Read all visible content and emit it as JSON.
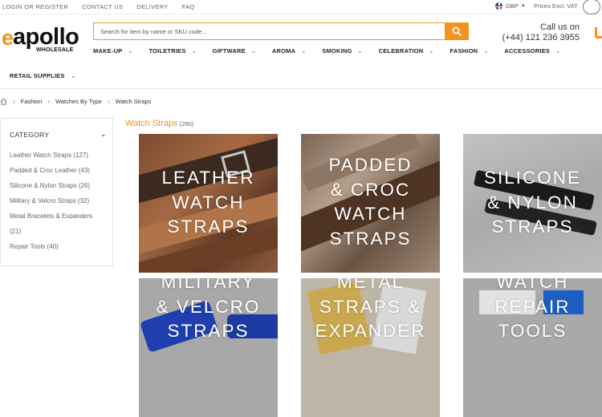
{
  "topbar": {
    "links": [
      "LOGIN OR REGISTER",
      "CONTACT US",
      "DELIVERY",
      "FAQ"
    ],
    "currency": "GBP",
    "prices_label": "Prices Excl. VAT"
  },
  "logo": {
    "name": "apollo",
    "sub": "WHOLESALE"
  },
  "search": {
    "placeholder": "Search for item by name or SKU code..."
  },
  "contact": {
    "title": "Call us on",
    "phone": "(+44) 121 236 3955"
  },
  "nav": {
    "items": [
      "MAKE-UP",
      "TOILETRIES",
      "GIFTWARE",
      "AROMA",
      "SMOKING",
      "CELEBRATION",
      "FASHION",
      "ACCESSORIES"
    ],
    "second_row": "RETAIL SUPPLIES"
  },
  "breadcrumb": [
    "Fashion",
    "Watches By Type",
    "Watch Straps"
  ],
  "sidebar": {
    "heading": "CATEGORY",
    "items": [
      "Leather Watch Straps (127)",
      "Padded & Croc Leather (43)",
      "Silicone & Nylon Straps (26)",
      "Military & Velcro Straps (32)",
      "Metal Bracelets & Expanders",
      "(21)",
      "Repair Tools (40)"
    ]
  },
  "results": {
    "title": "Watch Straps",
    "count": "(290)"
  },
  "tiles": [
    {
      "lines": [
        "LEATHER",
        "WATCH",
        "STRAPS"
      ]
    },
    {
      "lines": [
        "PADDED",
        "& CROC",
        "WATCH",
        "STRAPS"
      ]
    },
    {
      "lines": [
        "SILICONE",
        "& NYLON",
        "STRAPS"
      ]
    },
    {
      "lines": [
        "MILITARY",
        "& VELCRO",
        "STRAPS"
      ]
    },
    {
      "lines": [
        "METAL",
        "STRAPS &",
        "EXPANDER"
      ]
    },
    {
      "lines": [
        "WATCH",
        "REPAIR",
        "TOOLS"
      ]
    }
  ],
  "colors": {
    "accent": "#f39322"
  }
}
